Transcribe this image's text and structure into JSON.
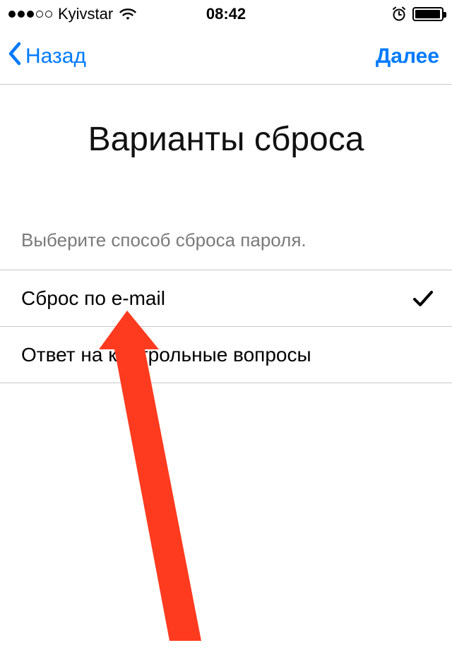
{
  "statusBar": {
    "carrier": "Kyivstar",
    "time": "08:42",
    "signalFilled": 3,
    "signalTotal": 5
  },
  "nav": {
    "back": "Назад",
    "next": "Далее"
  },
  "title": "Варианты сброса",
  "instruction": "Выберите способ сброса пароля.",
  "options": [
    {
      "label": "Сброс по e-mail",
      "selected": true
    },
    {
      "label": "Ответ на контрольные вопросы",
      "selected": false
    }
  ],
  "accentColor": "#007aff",
  "annotationArrowColor": "#ff3b1f"
}
